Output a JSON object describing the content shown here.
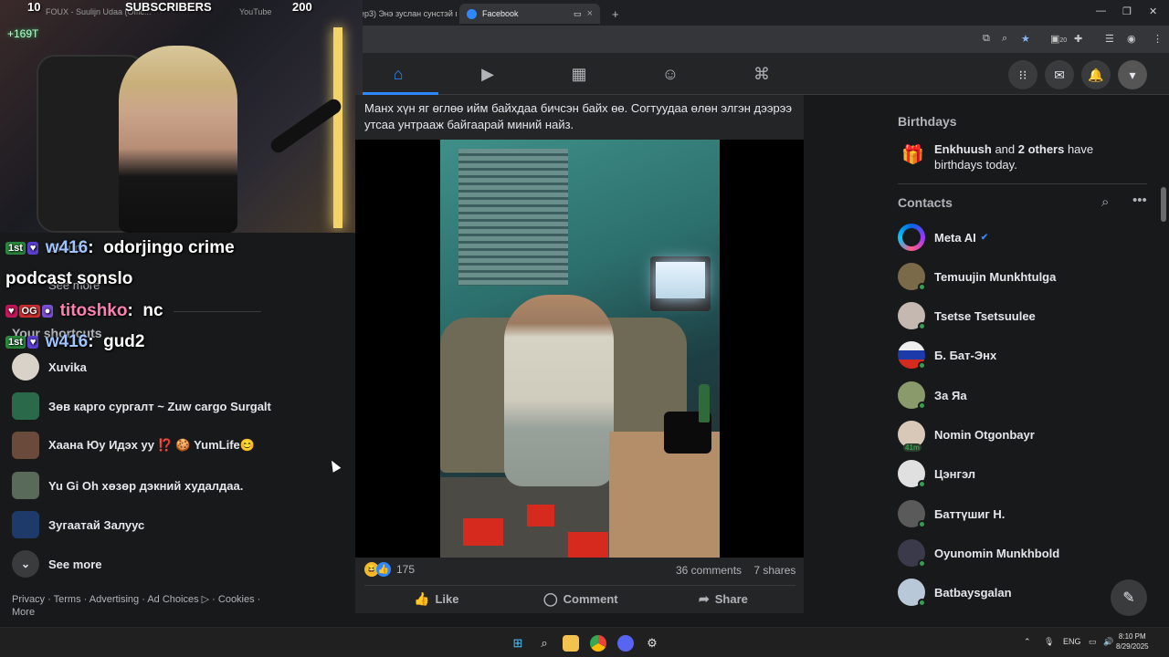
{
  "browser": {
    "tabs": [
      {
        "label": "(S2 ep3) Энэ зуслан сунстэй г...",
        "active": false
      },
      {
        "label": "Facebook",
        "active": true
      }
    ],
    "new_tab": "+"
  },
  "stream": {
    "sub_left_count": "10",
    "sub_label": "SUBSCRIBERS",
    "sub_right_count": "200",
    "faded_tab_text": "FOUX - Suulijn Udaa (Offic...",
    "youtube_text": "YouTube",
    "goal_text": "+169T",
    "chat": [
      {
        "user": "w416",
        "text": "odorjingo crime",
        "badges": [
          "1st",
          "♥"
        ]
      },
      {
        "user": "",
        "text": "podcast sonslo",
        "badges": []
      },
      {
        "user": "titoshko",
        "text": "nc",
        "badges": [
          "♥",
          "OG",
          "●"
        ]
      },
      {
        "user": "w416",
        "text": "gud2",
        "badges": [
          "1st",
          "♥"
        ]
      }
    ],
    "hidden_under_chat": [
      "Groups",
      "See more",
      "Your shortcuts"
    ]
  },
  "left_panel": {
    "shortcuts": [
      {
        "label": "Xuvika"
      },
      {
        "label": "Зөв карго сургалт ~ Zuw cargo Surgalt"
      },
      {
        "label": "Хаана Юу Идэх уу ⁉️ 🍪 YumLife😊"
      },
      {
        "label": "Yu Gi Oh хөзөр дэкний худалдаа."
      },
      {
        "label": "Зугаатай Залуус"
      }
    ],
    "see_more": "See more",
    "footer": "Privacy · Terms · Advertising · Ad Choices ▷ · Cookies · More"
  },
  "post": {
    "text": "Манх хүн яг өглөө ийм байхдаа бичсэн байх өө. Согтуудаа өлөн элгэн дээрээ утсаа унтрааж байгаарай миний найз.",
    "reaction_count": "175",
    "comments": "36 comments",
    "shares": "7 shares",
    "actions": {
      "like": "Like",
      "comment": "Comment",
      "share": "Share"
    }
  },
  "right_panel": {
    "birthdays_title": "Birthdays",
    "birthday_name": "Enkhuush",
    "birthday_and": " and ",
    "birthday_others": "2 others",
    "birthday_rest": " have birthdays today.",
    "contacts_title": "Contacts",
    "contacts": [
      {
        "name": "Meta AI",
        "verified": "✔"
      },
      {
        "name": "Temuujin Munkhtulga"
      },
      {
        "name": "Tsetse Tsetsuulee"
      },
      {
        "name": "Б. Бат-Энх"
      },
      {
        "name": "За Яа"
      },
      {
        "name": "Nomin Otgonbayr",
        "away": "41m"
      },
      {
        "name": "Цэнгэл"
      },
      {
        "name": "Баттүшиг Н."
      },
      {
        "name": "Oyunomin Munkhbold"
      },
      {
        "name": "Batbaysgalan"
      }
    ]
  },
  "taskbar": {
    "time": "8:10 PM",
    "date": "8/29/2025",
    "lang": "ENG",
    "notif_count": "20"
  },
  "colors": {
    "fb_blue": "#2d88ff",
    "bg": "#18191a",
    "card": "#242526",
    "online": "#31a24c"
  }
}
